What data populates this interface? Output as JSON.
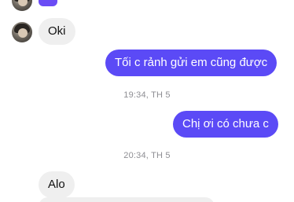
{
  "messages": {
    "incoming_1": "Oki",
    "outgoing_1": "Tối c rảnh gửi em cũng được",
    "outgoing_2": "Chị ơi có chưa c",
    "incoming_2": "Alo"
  },
  "timestamps": {
    "first": "19:34, TH 5",
    "second": "20:34, TH 5"
  },
  "colors": {
    "outgoing_bubble": "#5b4af6",
    "incoming_bubble": "#efefef",
    "timestamp_text": "#8e8e93"
  },
  "icons": {
    "avatar": "avatar",
    "sticker": "sticker-fragment"
  }
}
